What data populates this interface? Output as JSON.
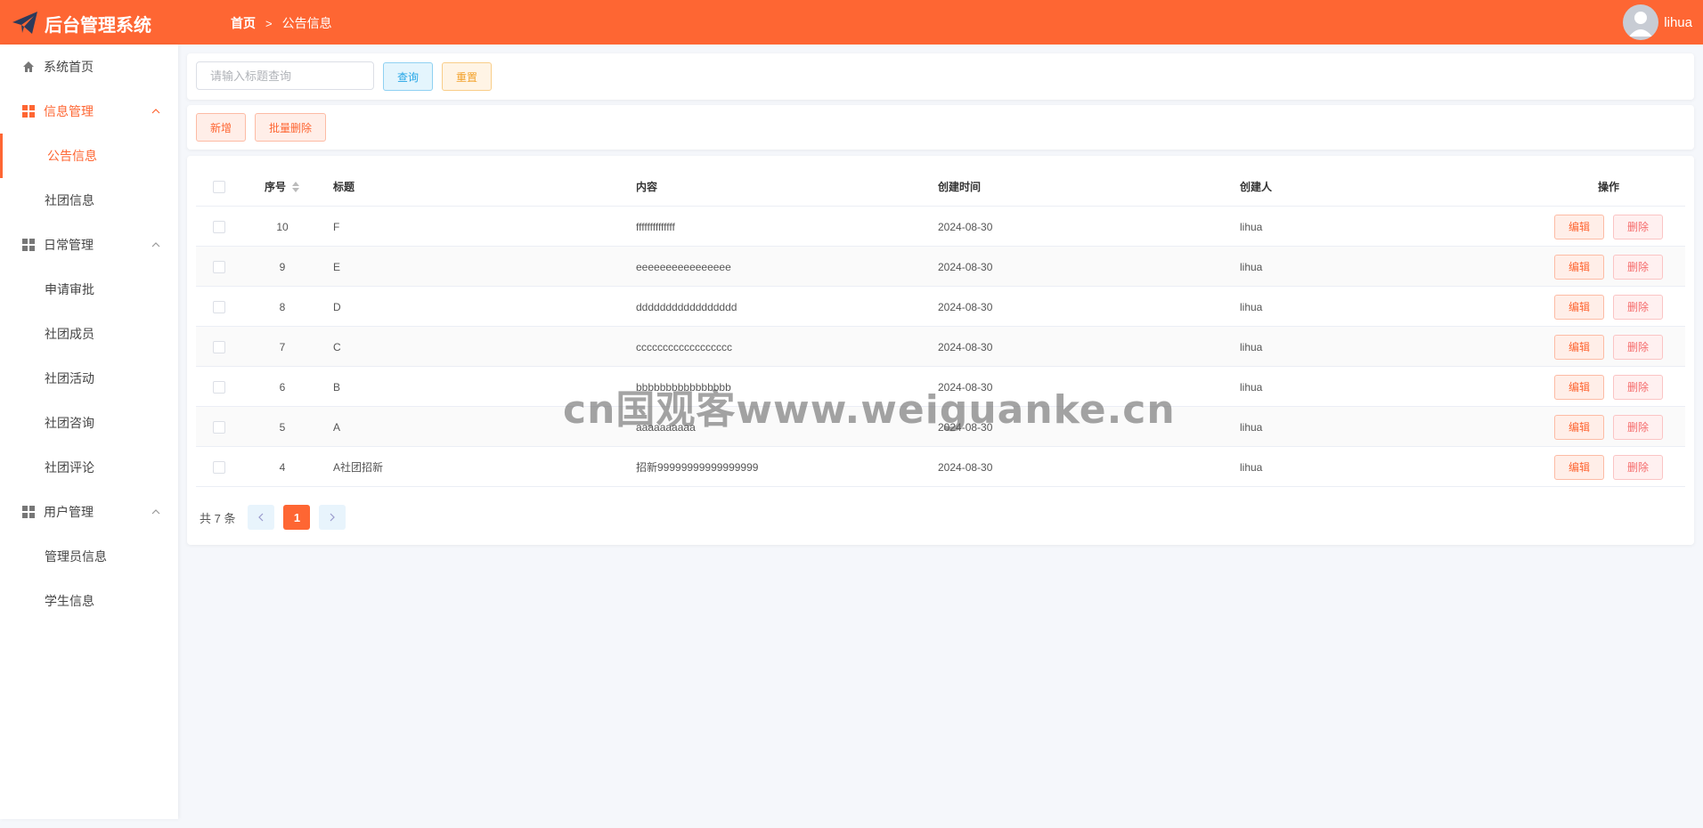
{
  "app": {
    "title": "后台管理系统"
  },
  "breadcrumb": {
    "home": "首页",
    "current": "公告信息"
  },
  "user": {
    "name": "lihua"
  },
  "sidebar": {
    "items": [
      {
        "label": "系统首页"
      },
      {
        "label": "信息管理"
      },
      {
        "label": "公告信息"
      },
      {
        "label": "社团信息"
      },
      {
        "label": "日常管理"
      },
      {
        "label": "申请审批"
      },
      {
        "label": "社团成员"
      },
      {
        "label": "社团活动"
      },
      {
        "label": "社团咨询"
      },
      {
        "label": "社团评论"
      },
      {
        "label": "用户管理"
      },
      {
        "label": "管理员信息"
      },
      {
        "label": "学生信息"
      }
    ]
  },
  "search": {
    "placeholder": "请输入标题查询",
    "query_label": "查询",
    "reset_label": "重置"
  },
  "actions": {
    "add_label": "新增",
    "batch_delete_label": "批量删除"
  },
  "table": {
    "headers": {
      "no": "序号",
      "title": "标题",
      "content": "内容",
      "time": "创建时间",
      "creator": "创建人",
      "ops": "操作"
    },
    "edit_label": "编辑",
    "delete_label": "删除",
    "rows": [
      {
        "no": "10",
        "title": "F",
        "content": "ffffffffffffff",
        "time": "2024-08-30",
        "creator": "lihua"
      },
      {
        "no": "9",
        "title": "E",
        "content": "eeeeeeeeeeeeeeee",
        "time": "2024-08-30",
        "creator": "lihua"
      },
      {
        "no": "8",
        "title": "D",
        "content": "ddddddddddddddddd",
        "time": "2024-08-30",
        "creator": "lihua"
      },
      {
        "no": "7",
        "title": "C",
        "content": "cccccccccccccccccc",
        "time": "2024-08-30",
        "creator": "lihua"
      },
      {
        "no": "6",
        "title": "B",
        "content": "bbbbbbbbbbbbbbbb",
        "time": "2024-08-30",
        "creator": "lihua"
      },
      {
        "no": "5",
        "title": "A",
        "content": "aaaaaaaaaa",
        "time": "2024-08-30",
        "creator": "lihua"
      },
      {
        "no": "4",
        "title": "A社团招新",
        "content": "招新99999999999999999",
        "time": "2024-08-30",
        "creator": "lihua"
      }
    ]
  },
  "pagination": {
    "total_text": "共 7 条",
    "current_page": "1"
  },
  "watermark": "cn国观客www.weiguanke.cn",
  "colors": {
    "accent": "#fe6633",
    "query": "#26a6e6",
    "reset": "#f2a12a",
    "danger": "#f56c6c"
  }
}
